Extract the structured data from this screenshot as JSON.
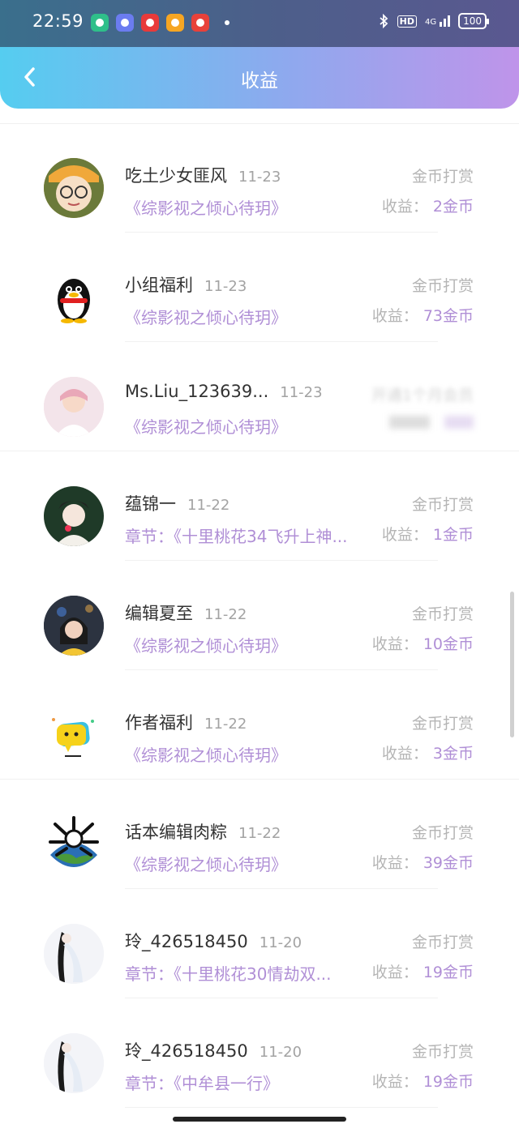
{
  "status_bar": {
    "time": "22:59",
    "network": "4G",
    "battery": "100",
    "hd": "HD"
  },
  "header": {
    "title": "收益",
    "back_icon": "chevron-left-icon",
    "gradient_start": "#55cdf0",
    "gradient_end": "#bf94ea"
  },
  "list": {
    "items": [
      {
        "name": "吃土少女匪风",
        "date": "11-23",
        "book": "《综影视之倾心待玥》",
        "type": "金币打赏",
        "income_label": "收益：",
        "amount": "2金币",
        "avatar_color": "#c8a24a"
      },
      {
        "name": "小组福利",
        "date": "11-23",
        "book": "《综影视之倾心待玥》",
        "type": "金币打赏",
        "income_label": "收益：",
        "amount": "73金币",
        "avatar_color": "#ffffff"
      },
      {
        "name": "Ms.Liu_123639...",
        "date": "11-23",
        "book": "《综影视之倾心待玥》",
        "type": "开通1个月会员",
        "income_label": "",
        "amount": "",
        "avatar_color": "#f4d6dc"
      },
      {
        "name": "蕴锦一",
        "date": "11-22",
        "book": "章节：《十里桃花34飞升上神...",
        "type": "金币打赏",
        "income_label": "收益：",
        "amount": "1金币",
        "avatar_color": "#e8e0d8"
      },
      {
        "name": "编辑夏至",
        "date": "11-22",
        "book": "《综影视之倾心待玥》",
        "type": "金币打赏",
        "income_label": "收益：",
        "amount": "10金币",
        "avatar_color": "#3b4250"
      },
      {
        "name": "作者福利",
        "date": "11-22",
        "book": "《综影视之倾心待玥》",
        "type": "金币打赏",
        "income_label": "收益：",
        "amount": "3金币",
        "avatar_color": "#ffffff"
      },
      {
        "name": "话本编辑肉粽",
        "date": "11-22",
        "book": "《综影视之倾心待玥》",
        "type": "金币打赏",
        "income_label": "收益：",
        "amount": "39金币",
        "avatar_color": "#ffffff"
      },
      {
        "name": "玲_426518450",
        "date": "11-20",
        "book": "章节：《十里桃花30情劫双...",
        "type": "金币打赏",
        "income_label": "收益：",
        "amount": "19金币",
        "avatar_color": "#f2f2f5"
      },
      {
        "name": "玲_426518450",
        "date": "11-20",
        "book": "章节：《中牟县一行》",
        "type": "金币打赏",
        "income_label": "收益：",
        "amount": "19金币",
        "avatar_color": "#f2f2f5"
      }
    ]
  },
  "colors": {
    "accent_purple": "#b08fd6",
    "muted_gray": "#b5b5b5"
  }
}
